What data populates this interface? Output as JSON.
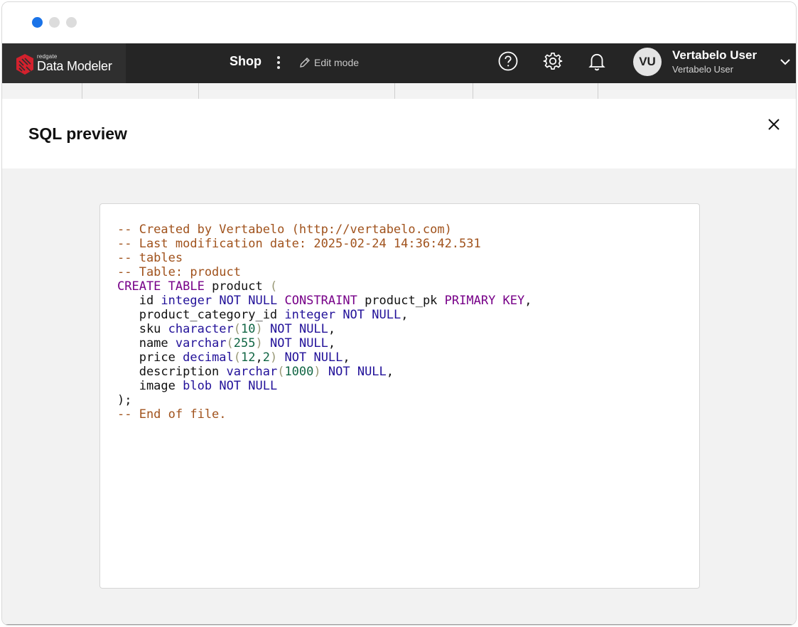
{
  "appbar": {
    "logo_small": "redgate",
    "logo_big": "Data Modeler",
    "project_name": "Shop",
    "edit_mode_label": "Edit mode",
    "user": {
      "initials": "VU",
      "name": "Vertabelo User",
      "subtitle": "Vertabelo User"
    }
  },
  "icons": {
    "help": "help-circle-icon",
    "settings": "gear-icon",
    "notifications": "bell-icon",
    "user_menu": "chevron-down-icon",
    "close": "close-icon",
    "edit": "pencil-icon"
  },
  "colors": {
    "accent": "#1a73e8",
    "appbar_bg": "#252525",
    "logo_red": "#d3212d",
    "comment": "#a0521c",
    "keyword": "#770088",
    "type": "#221199",
    "number": "#116644"
  },
  "modal": {
    "title": "SQL preview",
    "code_lines": [
      [
        {
          "t": "-- Created by Vertabelo (http://vertabelo.com)",
          "c": "cm"
        }
      ],
      [
        {
          "t": "-- Last modification date: 2025-02-24 14:36:42.531",
          "c": "cm"
        }
      ],
      [
        {
          "t": "-- tables",
          "c": "cm"
        }
      ],
      [
        {
          "t": "-- Table: product",
          "c": "cm"
        }
      ],
      [
        {
          "t": "CREATE TABLE",
          "c": "kw"
        },
        {
          "t": " product ",
          "c": "id"
        },
        {
          "t": "(",
          "c": "pn"
        }
      ],
      [
        {
          "t": "   id ",
          "c": "id"
        },
        {
          "t": "integer",
          "c": "ty"
        },
        {
          "t": " ",
          "c": "id"
        },
        {
          "t": "NOT NULL",
          "c": "ty"
        },
        {
          "t": " ",
          "c": "id"
        },
        {
          "t": "CONSTRAINT",
          "c": "kw"
        },
        {
          "t": " product_pk ",
          "c": "id"
        },
        {
          "t": "PRIMARY KEY",
          "c": "kw"
        },
        {
          "t": ",",
          "c": "id"
        }
      ],
      [
        {
          "t": "   product_category_id ",
          "c": "id"
        },
        {
          "t": "integer",
          "c": "ty"
        },
        {
          "t": " ",
          "c": "id"
        },
        {
          "t": "NOT NULL",
          "c": "ty"
        },
        {
          "t": ",",
          "c": "id"
        }
      ],
      [
        {
          "t": "   sku ",
          "c": "id"
        },
        {
          "t": "character",
          "c": "ty"
        },
        {
          "t": "(",
          "c": "pn"
        },
        {
          "t": "10",
          "c": "nu"
        },
        {
          "t": ")",
          "c": "pn"
        },
        {
          "t": " ",
          "c": "id"
        },
        {
          "t": "NOT NULL",
          "c": "ty"
        },
        {
          "t": ",",
          "c": "id"
        }
      ],
      [
        {
          "t": "   name ",
          "c": "id"
        },
        {
          "t": "varchar",
          "c": "ty"
        },
        {
          "t": "(",
          "c": "pn"
        },
        {
          "t": "255",
          "c": "nu"
        },
        {
          "t": ")",
          "c": "pn"
        },
        {
          "t": " ",
          "c": "id"
        },
        {
          "t": "NOT NULL",
          "c": "ty"
        },
        {
          "t": ",",
          "c": "id"
        }
      ],
      [
        {
          "t": "   price ",
          "c": "id"
        },
        {
          "t": "decimal",
          "c": "ty"
        },
        {
          "t": "(",
          "c": "pn"
        },
        {
          "t": "12",
          "c": "nu"
        },
        {
          "t": ",",
          "c": "id"
        },
        {
          "t": "2",
          "c": "nu"
        },
        {
          "t": ")",
          "c": "pn"
        },
        {
          "t": " ",
          "c": "id"
        },
        {
          "t": "NOT NULL",
          "c": "ty"
        },
        {
          "t": ",",
          "c": "id"
        }
      ],
      [
        {
          "t": "   description ",
          "c": "id"
        },
        {
          "t": "varchar",
          "c": "ty"
        },
        {
          "t": "(",
          "c": "pn"
        },
        {
          "t": "1000",
          "c": "nu"
        },
        {
          "t": ")",
          "c": "pn"
        },
        {
          "t": " ",
          "c": "id"
        },
        {
          "t": "NOT NULL",
          "c": "ty"
        },
        {
          "t": ",",
          "c": "id"
        }
      ],
      [
        {
          "t": "   image ",
          "c": "id"
        },
        {
          "t": "blob",
          "c": "ty"
        },
        {
          "t": " ",
          "c": "id"
        },
        {
          "t": "NOT NULL",
          "c": "ty"
        }
      ],
      [
        {
          "t": ");",
          "c": "id"
        }
      ],
      [
        {
          "t": "-- End of file.",
          "c": "cm"
        }
      ]
    ]
  }
}
